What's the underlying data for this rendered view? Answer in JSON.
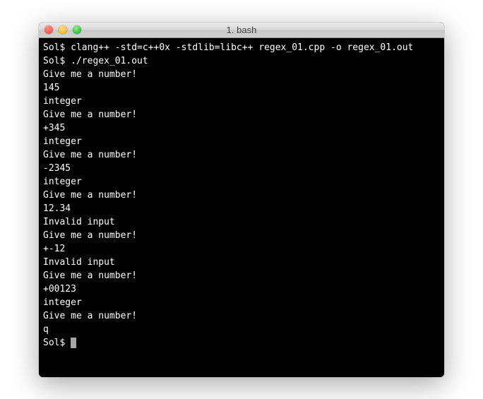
{
  "window": {
    "title": "1. bash"
  },
  "prompt": "Sol$ ",
  "lines": [
    "Sol$ clang++ -std=c++0x -stdlib=libc++ regex_01.cpp -o regex_01.out",
    "Sol$ ./regex_01.out",
    "Give me a number!",
    "145",
    "integer",
    "Give me a number!",
    "+345",
    "integer",
    "Give me a number!",
    "-2345",
    "integer",
    "Give me a number!",
    "12.34",
    "Invalid input",
    "Give me a number!",
    "+-12",
    "Invalid input",
    "Give me a number!",
    "+00123",
    "integer",
    "Give me a number!",
    "q"
  ],
  "final_prompt": "Sol$ "
}
